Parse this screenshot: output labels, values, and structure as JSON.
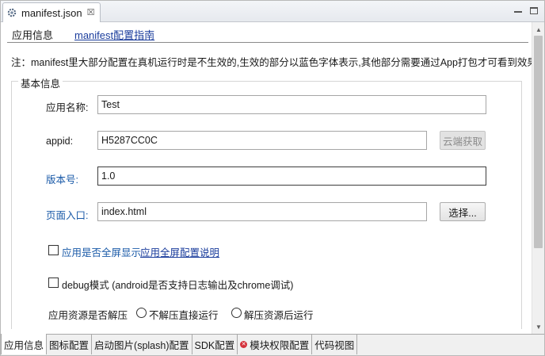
{
  "editor": {
    "tab_label": "manifest.json",
    "tab_close": "☒"
  },
  "header": {
    "title": "应用信息",
    "guide_link": "manifest配置指南"
  },
  "note": "注：manifest里大部分配置在真机运行时是不生效的,生效的部分以蓝色字体表示,其他部分需要通过App打包才可看到效果",
  "basic_info": {
    "legend": "基本信息",
    "app_name": {
      "label": "应用名称:",
      "value": "Test"
    },
    "appid": {
      "label": "appid:",
      "value": "H5287CC0C",
      "cloud_button": "云端获取"
    },
    "version": {
      "label": "版本号:",
      "value": "1.0"
    },
    "entry": {
      "label": "页面入口:",
      "value": "index.html",
      "choose_button": "选择..."
    },
    "fullscreen": {
      "label": "应用是否全屏显示",
      "link": "应用全屏配置说明",
      "checked": false
    },
    "debug": {
      "label": "debug模式 (android是否支持日志输出及chrome调试)",
      "checked": false
    },
    "unpack": {
      "label": "应用资源是否解压",
      "option_no": "不解压直接运行",
      "option_yes": "解压资源后运行"
    }
  },
  "bottom_tabs": [
    {
      "label": "应用信息",
      "active": true
    },
    {
      "label": "图标配置"
    },
    {
      "label": "启动图片(splash)配置"
    },
    {
      "label": "SDK配置"
    },
    {
      "label": "模块权限配置",
      "icon": "error-icon"
    },
    {
      "label": "代码视图"
    }
  ],
  "colors": {
    "link": "#1a3c9c",
    "blue_label": "#1a5aa8",
    "error": "#d4323c"
  }
}
